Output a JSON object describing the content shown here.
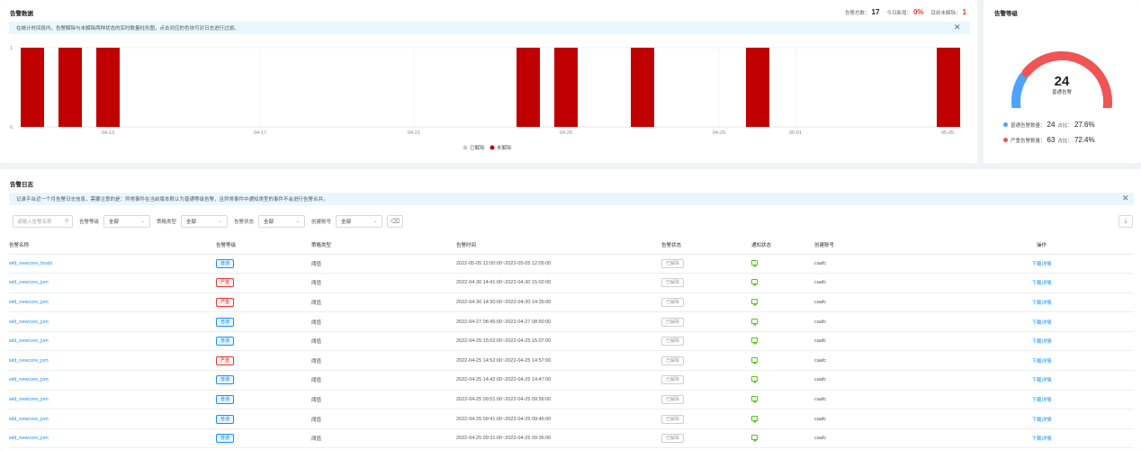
{
  "alarm_data": {
    "title": "告警数据",
    "stats": [
      {
        "label": "告警总数：",
        "value": "17",
        "color": "#222222"
      },
      {
        "label": "今日新增：",
        "value": "0%",
        "color": "#e53935"
      },
      {
        "label": "目前未解除：",
        "value": "1",
        "color": "#e53935"
      }
    ],
    "info": "在统计时间段内，告警解除与未解除两种状态的实时数量柱形图，点击对应的色块可对日志进行过滤。"
  },
  "chart_data": {
    "type": "bar",
    "x_ticks": [
      "04-13",
      "04-17",
      "04-21",
      "04-25",
      "04-29",
      "05-01",
      "05-05"
    ],
    "y_ticks": [
      "0",
      "1"
    ],
    "ylim": [
      0,
      1
    ],
    "colors": {
      "resolved": "#cccccc",
      "unresolved": "#c00000"
    },
    "series": [
      {
        "name": "已解除",
        "color": "#cccccc",
        "values": []
      },
      {
        "name": "未解除",
        "color": "#c00000",
        "values": [
          1,
          1,
          1,
          1,
          1,
          1,
          1,
          1
        ]
      }
    ]
  },
  "alarm_level": {
    "title": "告警等级",
    "gauge": {
      "value": "24",
      "label": "普通告警",
      "fraction": 0.276,
      "normal_color": "#4da3ff",
      "severe_color": "#f05454"
    },
    "legend": [
      {
        "label": "普通告警数量：",
        "value": "24",
        "pct_label": "占比：",
        "pct": "27.6%",
        "color": "#4da3ff"
      },
      {
        "label": "严重告警数量：",
        "value": "63",
        "pct_label": "占比：",
        "pct": "72.4%",
        "color": "#f05454"
      }
    ]
  },
  "alarm_log": {
    "title": "告警日志",
    "info": "记录平台近一个月告警日志信息，需要注意的是：异常事件在当前版本默认为普通等级告警，且异常事件中通知类型的事件不会进行告警合并。",
    "filters": {
      "search_placeholder": "请输入告警名称",
      "level_label": "告警等级",
      "level_value": "全部",
      "policy_label": "策略类型",
      "policy_value": "全部",
      "status_label": "告警状态",
      "status_value": "全部",
      "account_label": "创建账号",
      "account_value": "全部"
    },
    "columns": [
      "告警名称",
      "告警等级",
      "策略类型",
      "告警时间",
      "告警状态",
      "通知状态",
      "创建账号",
      "操作"
    ],
    "rows": [
      {
        "name": "wld_newcore_hosts",
        "level": "普通",
        "level_type": "normal",
        "policy": "阈值",
        "time": "2022-05-05 12:00:00~2022-05-05 12:05:00",
        "status": "已解除",
        "account": "caafc",
        "action": "下载详情"
      },
      {
        "name": "wld_newcore_jvm",
        "level": "严重",
        "level_type": "severe",
        "policy": "阈值",
        "time": "2022-04-30 14:41:00~2022-04-30 15:02:00",
        "status": "已解除",
        "account": "caafc",
        "action": "下载详情"
      },
      {
        "name": "wld_newcore_jvm",
        "level": "严重",
        "level_type": "severe",
        "policy": "阈值",
        "time": "2022-04-30 14:30:00~2022-04-30 14:35:00",
        "status": "已解除",
        "account": "caafc",
        "action": "下载详情"
      },
      {
        "name": "wld_newcore_jvm",
        "level": "普通",
        "level_type": "normal",
        "policy": "阈值",
        "time": "2022-04-27 08:45:00~2022-04-27 08:50:00",
        "status": "已解除",
        "account": "caafc",
        "action": "下载详情"
      },
      {
        "name": "wld_newcore_jvm",
        "level": "普通",
        "level_type": "normal",
        "policy": "阈值",
        "time": "2022-04-25 15:02:00~2022-04-25 15:07:00",
        "status": "已解除",
        "account": "caafc",
        "action": "下载详情"
      },
      {
        "name": "wld_newcore_jvm",
        "level": "严重",
        "level_type": "severe",
        "policy": "阈值",
        "time": "2022-04-25 14:52:00~2022-04-25 14:57:00",
        "status": "已解除",
        "account": "caafc",
        "action": "下载详情"
      },
      {
        "name": "wld_newcore_jvm",
        "level": "普通",
        "level_type": "normal",
        "policy": "阈值",
        "time": "2022-04-25 14:42:00~2022-04-25 14:47:00",
        "status": "已解除",
        "account": "caafc",
        "action": "下载详情"
      },
      {
        "name": "wld_newcore_jvm",
        "level": "普通",
        "level_type": "normal",
        "policy": "阈值",
        "time": "2022-04-25 09:51:00~2022-04-25 09:56:00",
        "status": "已解除",
        "account": "caafc",
        "action": "下载详情"
      },
      {
        "name": "wld_newcore_jvm",
        "level": "普通",
        "level_type": "normal",
        "policy": "阈值",
        "time": "2022-04-25 09:41:00~2022-04-25 09:46:00",
        "status": "已解除",
        "account": "caafc",
        "action": "下载详情"
      },
      {
        "name": "wld_newcore_jvm",
        "level": "普通",
        "level_type": "normal",
        "policy": "阈值",
        "time": "2022-04-25 09:31:00~2022-04-25 09:36:00",
        "status": "已解除",
        "account": "caafc",
        "action": "下载详情"
      }
    ]
  }
}
